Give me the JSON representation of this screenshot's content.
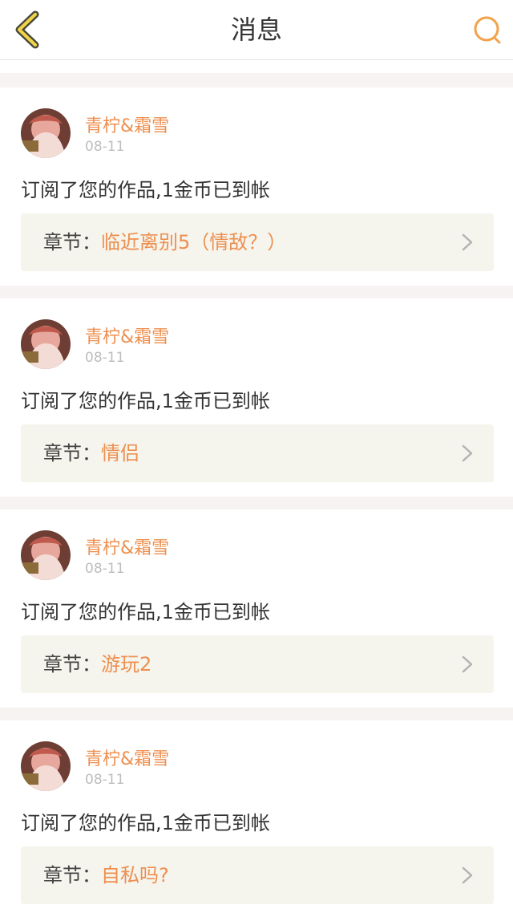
{
  "header": {
    "title": "消息",
    "back_icon": "back-arrow-icon",
    "search_icon": "search-icon",
    "accent": "#f2a24b"
  },
  "messages": [
    {
      "username": "青柠&霜雪",
      "date": "08-11",
      "text": "订阅了您的作品,1金币已到帐",
      "chapter_label": "章节：",
      "chapter_title": "临近离别5（情敌？）"
    },
    {
      "username": "青柠&霜雪",
      "date": "08-11",
      "text": "订阅了您的作品,1金币已到帐",
      "chapter_label": "章节：",
      "chapter_title": "情侣"
    },
    {
      "username": "青柠&霜雪",
      "date": "08-11",
      "text": "订阅了您的作品,1金币已到帐",
      "chapter_label": "章节：",
      "chapter_title": "游玩2"
    },
    {
      "username": "青柠&霜雪",
      "date": "08-11",
      "text": "订阅了您的作品,1金币已到帐",
      "chapter_label": "章节：",
      "chapter_title": "自私吗?"
    }
  ],
  "colors": {
    "username": "#ee8f4f",
    "chapter_title": "#ee8f4f",
    "chapter_box": "#f5f4ed",
    "separator": "#f7f3f3"
  }
}
